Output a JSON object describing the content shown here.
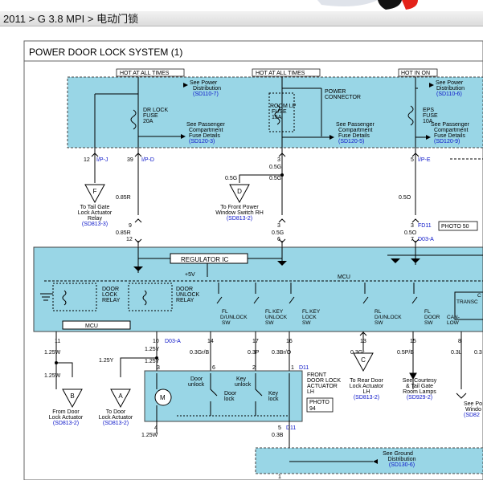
{
  "breadcrumb": "2011 > G 3.8 MPI > 电动门锁",
  "title": "POWER DOOR LOCK SYSTEM (1)",
  "colors": {
    "module_fill": "#99d6e6",
    "link_blue": "#0a14c8",
    "photo_box": "#000000"
  },
  "power_labels": {
    "hot1": "HOT AT ALL TIMES",
    "hot2": "HOT AT ALL TIMES",
    "hot3": "HOT IN ON"
  },
  "refs": {
    "pd1_a": "See Power",
    "pd1_b": "Distribution",
    "pd1_c": "(SD110-7)",
    "pd2_a": "See Power",
    "pd2_b": "Distribution",
    "pd2_c": "(SD110-6)",
    "pc1_a": "See Passenger",
    "pc1_b": "Compartment",
    "pc1_c": "Fuse Details",
    "pc1_d": "(SD120-3)",
    "pc2_a": "See Passenger",
    "pc2_b": "Compartment",
    "pc2_c": "Fuse Details",
    "pc2_d": "(SD120-5)",
    "pc3_a": "See Passenger",
    "pc3_b": "Compartment",
    "pc3_c": "Fuse Details",
    "pc3_d": "(SD120-9)"
  },
  "fuses": {
    "dr_a": "DR LOCK",
    "dr_b": "FUSE",
    "dr_c": "20A",
    "rm_a": "ROOM LP",
    "rm_b": "FUSE",
    "rm_c": "15A",
    "eps_a": "EPS",
    "eps_b": "FUSE",
    "eps_c": "10A",
    "pconn_a": "POWER",
    "pconn_b": "CONNECTOR"
  },
  "connectors": {
    "p12": "12",
    "ipj": "I/P-J",
    "p39": "39",
    "ipd": "I/P-D",
    "p3": "3",
    "p5": "5",
    "ipe": "I/P-E",
    "p9": "9",
    "p12b": "12",
    "p3b": "3",
    "fd11": "FD11",
    "p6": "6",
    "p7": "7",
    "d03a": "D03-A"
  },
  "wires": {
    "w085r": "0.85R",
    "w085r2": "0.85R",
    "w05g": "0.5G",
    "w05g2": "0.5G",
    "w05g3": "0.5G",
    "w05g4": "0.5G",
    "w05o": "0.5O",
    "w05o2": "0.5O"
  },
  "photo_box": "PHOTO 50",
  "photo_box2_a": "PHOTO",
  "photo_box2_b": "94",
  "offpage": {
    "F_a": "To Tail Gate",
    "F_b": "Lock Actuator",
    "F_c": "Relay",
    "F_d": "(SD813-3)",
    "F_letter": "F",
    "D_a": "To Front Power",
    "D_b": "Window Switch RH",
    "D_c": "(SD813-2)",
    "D_letter": "D",
    "B_a": "From Door",
    "B_b": "Lock Actuator",
    "B_c": "(SD813-2)",
    "B_letter": "B",
    "A_a": "To Door",
    "A_b": "Lock Actuator",
    "A_c": "(SD813-2)",
    "A_letter": "A",
    "C_a": "To Rear Door",
    "C_b": "Lock Actuator",
    "C_c": "LH",
    "C_d": "(SD813-2)",
    "C_letter": "C",
    "E_a": "See Courtesy",
    "E_b": "& Tail Gate",
    "E_c": "Room Lamps",
    "E_d": "(SD929-2)",
    "G_a": "See Po",
    "G_b": "Windo",
    "G_c": "(SD82"
  },
  "module": {
    "reg": "REGULATOR IC",
    "plus5v": "+5V",
    "mcu": "MCU",
    "mcu2": "MCU",
    "dl_a": "DOOR",
    "dl_b": "LOCK",
    "dl_c": "RELAY",
    "du_a": "DOOR",
    "du_b": "UNLOCK",
    "du_c": "RELAY",
    "sw1_a": "FL",
    "sw1_b": "D/UNLOCK",
    "sw1_c": "SW",
    "sw2_a": "FL KEY",
    "sw2_b": "UNLOCK",
    "sw2_c": "SW",
    "sw3_a": "FL KEY",
    "sw3_b": "LOCK",
    "sw3_c": "SW",
    "sw4_a": "RL",
    "sw4_b": "D/UNLOCK",
    "sw4_c": "SW",
    "sw5_a": "FL",
    "sw5_b": "DOOR",
    "sw5_c": "SW",
    "can_a": "CAN-",
    "can_b": "LOW",
    "trans_a": "C",
    "trans_b": "TRANSC"
  },
  "lower_pins": {
    "p11": "11",
    "p10": "10",
    "d03a": "D03-A",
    "p14": "14",
    "p17": "17",
    "p16": "16",
    "p13": "13",
    "p15": "15",
    "p8": "8",
    "p6": "6",
    "p2": "2",
    "p1": "1",
    "d11": "D11",
    "p3": "3",
    "p4": "4",
    "p5": "5",
    "d11b": "D11",
    "p1b": "1"
  },
  "lower_wires": {
    "w125w": "1.25W",
    "w125w2": "1.25W",
    "w125y": "1.25Y",
    "w125y2": "1.25Y",
    "w125y3": "1.25Y",
    "w03gr": "0.3Gr/B",
    "w03p": "0.3P",
    "w03ro": "0.3Br/O",
    "w03g": "0.3Gr",
    "w05pb": "0.5P/B",
    "w03l": "0.3L",
    "w03x": "0.3",
    "w125w3": "1.25W",
    "w03b": "0.3B"
  },
  "actuator": {
    "t1": "FRONT",
    "t2": "DOOR LOCK",
    "t3": "ACTUATOR",
    "t4": "LH",
    "du1": "Door",
    "du2": "unlock",
    "dl1": "Door",
    "dl2": "lock",
    "ku1": "Key",
    "ku2": "unlock",
    "kl1": "Key",
    "kl2": "lock",
    "m": "M"
  },
  "ground": {
    "a": "See Ground",
    "b": "Distribution",
    "c": "(SD130-6)"
  }
}
